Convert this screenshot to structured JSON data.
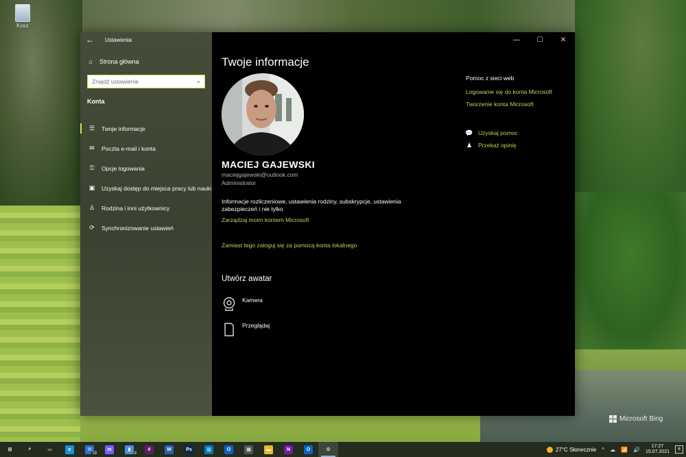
{
  "desktop": {
    "recycle_label": "Kosz",
    "bing_label": "Microsoft Bing"
  },
  "window": {
    "title": "Ustawienia",
    "minimize": "—",
    "maximize": "☐",
    "close": "✕"
  },
  "sidebar": {
    "home_label": "Strona główna",
    "search_placeholder": "Znajdź ustawienie",
    "section_title": "Konta",
    "items": [
      {
        "label": "Twoje informacje",
        "icon": "☰"
      },
      {
        "label": "Poczta e-mail i konta",
        "icon": "✉"
      },
      {
        "label": "Opcje logowania",
        "icon": "⚿"
      },
      {
        "label": "Uzyskaj dostęp do miejsca pracy lub nauki",
        "icon": "▣"
      },
      {
        "label": "Rodzina i inni użytkownicy",
        "icon": "♙"
      },
      {
        "label": "Synchronizowanie ustawień",
        "icon": "⟳"
      }
    ]
  },
  "main": {
    "title": "Twoje informacje",
    "user_name": "MACIEJ GAJEWSKI",
    "user_email": "maciejgajewski@outlook.com",
    "user_role": "Administrator",
    "info_text": "Informacje rozliczeniowe, ustawienia rodziny, subskrypcje, ustawienia zabezpieczeń i nie tylko",
    "manage_link": "Zarządzaj moim kontem Microsoft",
    "local_link": "Zamiast tego zaloguj się za pomocą konta lokalnego",
    "avatar_heading": "Utwórz awatar",
    "camera_label": "Kamera",
    "browse_label": "Przeglądaj"
  },
  "help": {
    "title": "Pomoc z sieci web",
    "links": [
      "Logowanie się do konta Microsoft",
      "Tworzenie konta Microsoft"
    ],
    "get_help": "Uzyskaj pomoc",
    "feedback": "Przekaż opinię"
  },
  "taskbar": {
    "apps": [
      {
        "name": "start",
        "glyph": "⊞",
        "color": "#ffffff"
      },
      {
        "name": "search",
        "glyph": "⌕",
        "color": "#ffffff"
      },
      {
        "name": "task-view",
        "glyph": "▭",
        "color": "#ffffff"
      },
      {
        "name": "edge",
        "glyph": "e",
        "color": "#1f8fd6"
      },
      {
        "name": "mail",
        "glyph": "✉",
        "color": "#2f6fd0",
        "badge": "19"
      },
      {
        "name": "messenger",
        "glyph": "m",
        "color": "#7b5cff"
      },
      {
        "name": "phone",
        "glyph": "▮",
        "color": "#4a8fd8",
        "badge": "9"
      },
      {
        "name": "slack",
        "glyph": "#",
        "color": "#611f69"
      },
      {
        "name": "word",
        "glyph": "W",
        "color": "#2b5fb4"
      },
      {
        "name": "photoshop",
        "glyph": "Ps",
        "color": "#0a2a4a"
      },
      {
        "name": "trello",
        "glyph": "▥",
        "color": "#0079bf"
      },
      {
        "name": "outlook-calendar",
        "glyph": "O",
        "color": "#0f62c4"
      },
      {
        "name": "calculator",
        "glyph": "▦",
        "color": "#555555"
      },
      {
        "name": "file-explorer",
        "glyph": "▬",
        "color": "#e8b830"
      },
      {
        "name": "onenote",
        "glyph": "N",
        "color": "#7719aa"
      },
      {
        "name": "outlook",
        "glyph": "O",
        "color": "#0a64c8"
      },
      {
        "name": "settings",
        "glyph": "⚙",
        "color": "#ffffff"
      }
    ],
    "weather": "27°C  Słonecznie",
    "time": "17:27",
    "date": "15.07.2021",
    "notifications": "6"
  }
}
